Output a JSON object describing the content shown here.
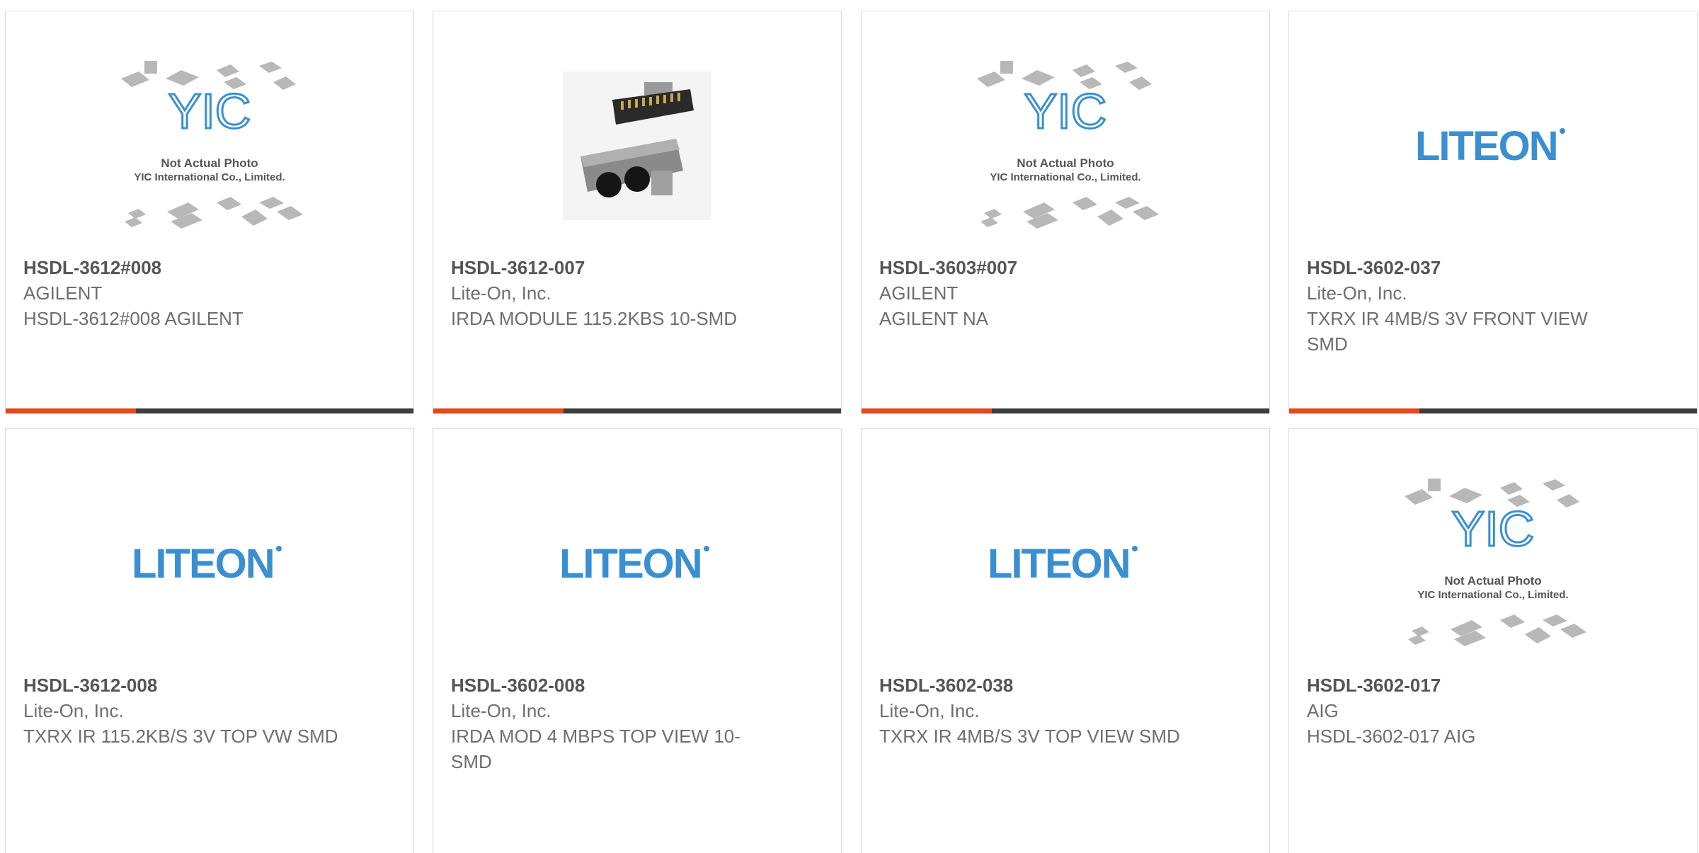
{
  "colors": {
    "accent": "#e8461c",
    "bar_dark": "#3d3d3d",
    "liteon_blue": "#3a8fd0",
    "border": "#dcdcdc"
  },
  "placeholder_image": {
    "line1": "Not Actual Photo",
    "line2": "YIC International Co., Limited.",
    "logo": "YIC"
  },
  "liteon_logo_text": "LITEON",
  "products": [
    {
      "part_number": "HSDL-3612#008",
      "manufacturer": "AGILENT",
      "description": "HSDL-3612#008 AGILENT",
      "image": "yic-placeholder"
    },
    {
      "part_number": "HSDL-3612-007",
      "manufacturer": "Lite-On, Inc.",
      "description": "IRDA MODULE 115.2KBS 10-SMD",
      "image": "irda-module-photo"
    },
    {
      "part_number": "HSDL-3603#007",
      "manufacturer": "AGILENT",
      "description": "AGILENT NA",
      "image": "yic-placeholder"
    },
    {
      "part_number": "HSDL-3602-037",
      "manufacturer": "Lite-On, Inc.",
      "description": "TXRX IR 4MB/S 3V FRONT VIEW SMD",
      "image": "liteon-logo"
    },
    {
      "part_number": "HSDL-3612-008",
      "manufacturer": "Lite-On, Inc.",
      "description": "TXRX IR 115.2KB/S 3V TOP VW SMD",
      "image": "liteon-logo"
    },
    {
      "part_number": "HSDL-3602-008",
      "manufacturer": "Lite-On, Inc.",
      "description": "IRDA MOD 4 MBPS TOP VIEW 10-SMD",
      "image": "liteon-logo"
    },
    {
      "part_number": "HSDL-3602-038",
      "manufacturer": "Lite-On, Inc.",
      "description": "TXRX IR 4MB/S 3V TOP VIEW SMD",
      "image": "liteon-logo"
    },
    {
      "part_number": "HSDL-3602-017",
      "manufacturer": "AIG",
      "description": "HSDL-3602-017 AIG",
      "image": "yic-placeholder"
    }
  ]
}
